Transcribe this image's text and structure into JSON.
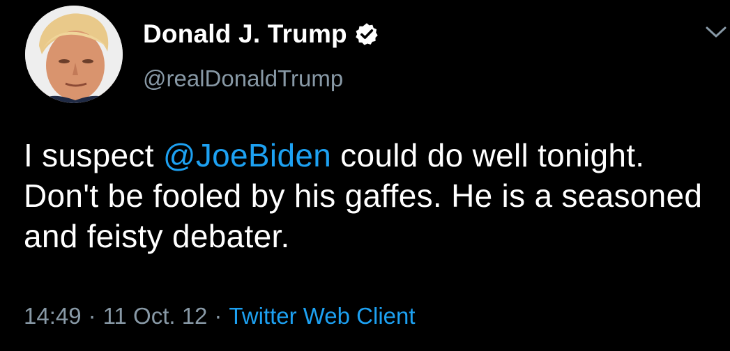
{
  "author": {
    "display_name": "Donald J. Trump",
    "handle": "@realDonaldTrump",
    "verified": true
  },
  "tweet": {
    "text_before": "I suspect ",
    "mention": "@JoeBiden",
    "text_after": " could do well tonight. Don't be fooled by his gaffes. He is a seasoned and feisty debater."
  },
  "meta": {
    "time": "14:49",
    "separator": "·",
    "date": "11 Oct. 12",
    "source": "Twitter Web Client"
  },
  "icons": {
    "verified": "verified-badge-icon",
    "menu": "chevron-down-icon"
  },
  "colors": {
    "background": "#000000",
    "text": "#ffffff",
    "secondary": "#8899a6",
    "link": "#1da1f2"
  }
}
